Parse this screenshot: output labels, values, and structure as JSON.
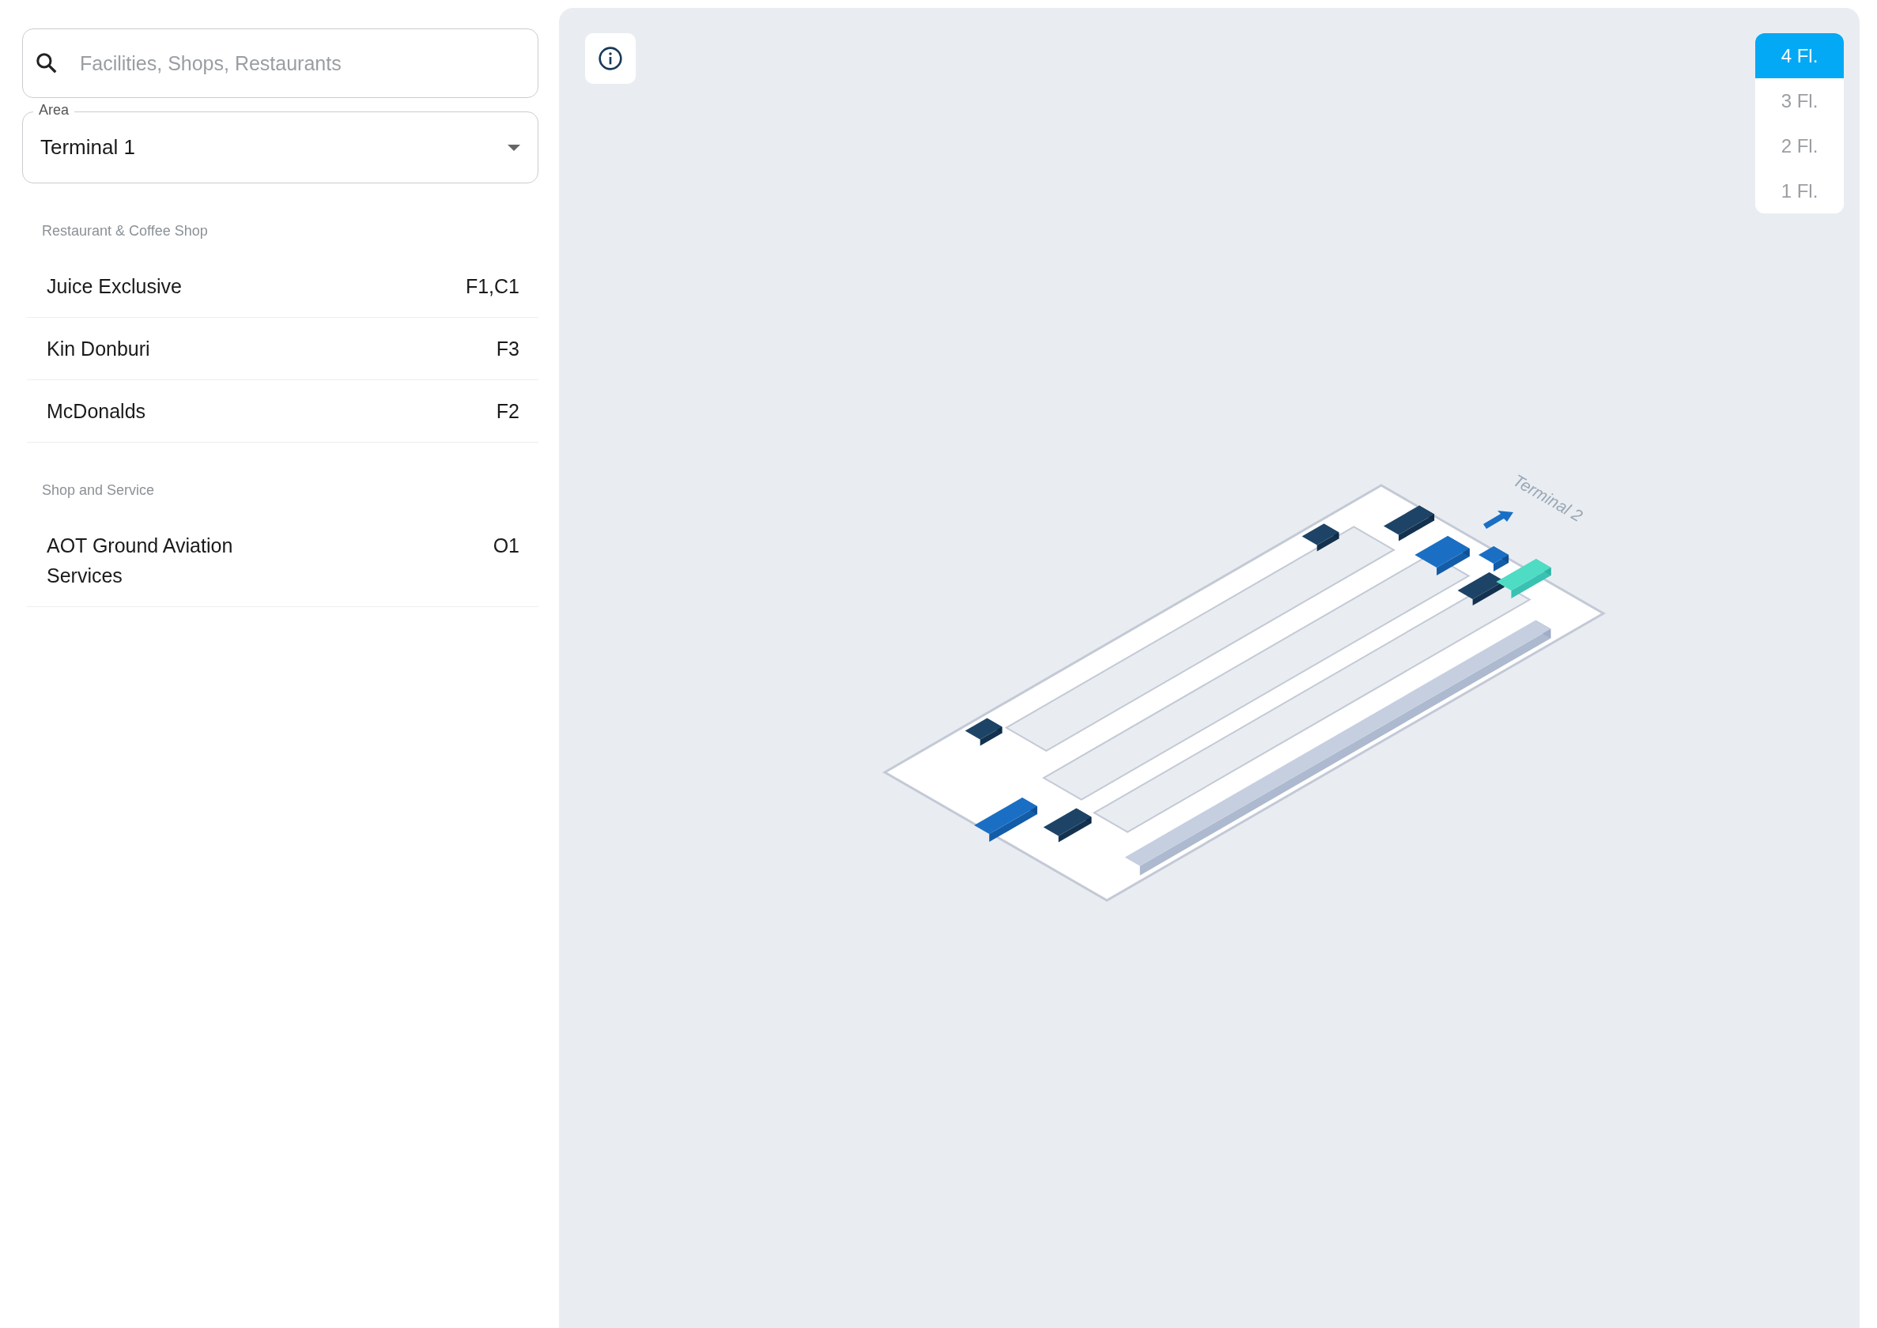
{
  "search": {
    "placeholder": "Facilities, Shops, Restaurants"
  },
  "area": {
    "label": "Area",
    "value": "Terminal 1"
  },
  "sections": [
    {
      "title": "Restaurant & Coffee Shop",
      "items": [
        {
          "name": "Juice Exclusive",
          "location": "F1,C1"
        },
        {
          "name": "Kin Donburi",
          "location": "F3"
        },
        {
          "name": "McDonalds",
          "location": "F2"
        }
      ]
    },
    {
      "title": "Shop and Service",
      "items": [
        {
          "name": "AOT Ground Aviation Services",
          "location": "O1"
        }
      ]
    }
  ],
  "floors": [
    {
      "label": "4 Fl.",
      "selected": true
    },
    {
      "label": "3 Fl.",
      "selected": false
    },
    {
      "label": "2 Fl.",
      "selected": false
    },
    {
      "label": "1 Fl.",
      "selected": false
    }
  ],
  "map": {
    "direction_label": "Terminal 2"
  }
}
